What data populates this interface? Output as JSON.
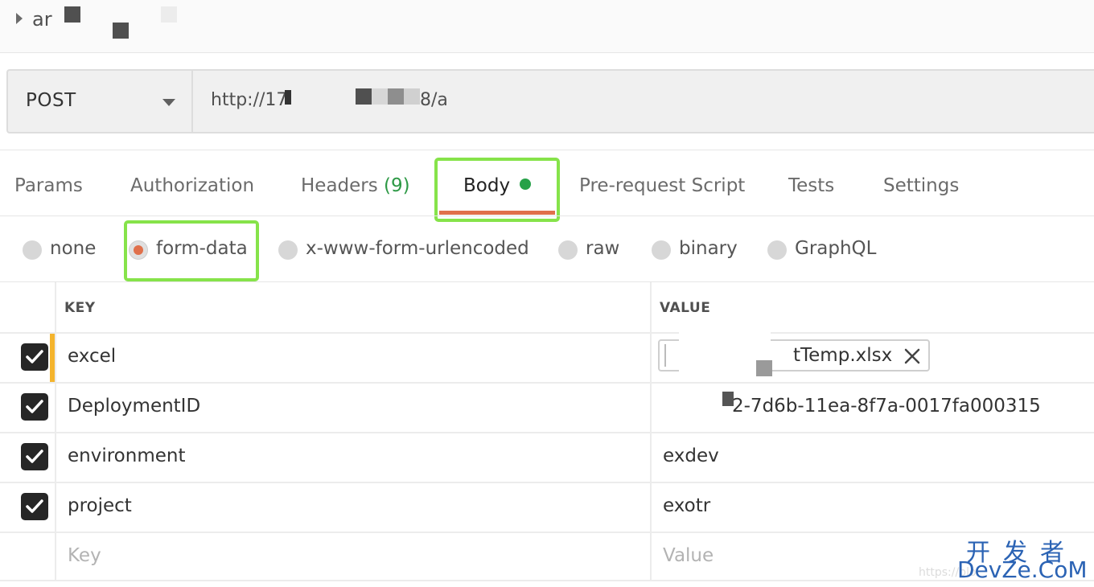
{
  "request": {
    "name": "ar",
    "method": "POST",
    "url_start": "http://17",
    "url_end": "8/a"
  },
  "tabs": [
    {
      "label": "Params"
    },
    {
      "label": "Authorization"
    },
    {
      "label": "Headers",
      "count": "(9)"
    },
    {
      "label": "Body",
      "active": true
    },
    {
      "label": "Pre-request Script"
    },
    {
      "label": "Tests"
    },
    {
      "label": "Settings"
    }
  ],
  "body_types": [
    {
      "label": "none",
      "selected": false
    },
    {
      "label": "form-data",
      "selected": true
    },
    {
      "label": "x-www-form-urlencoded",
      "selected": false
    },
    {
      "label": "raw",
      "selected": false
    },
    {
      "label": "binary",
      "selected": false
    },
    {
      "label": "GraphQL",
      "selected": false
    }
  ],
  "table": {
    "key_header": "KEY",
    "value_header": "VALUE",
    "rows": [
      {
        "key": "excel",
        "value": "tTemp.xlsx",
        "checked": true
      },
      {
        "key": "DeploymentID",
        "value": "2-7d6b-11ea-8f7a-0017fa000315",
        "checked": true
      },
      {
        "key": "environment",
        "value": "exdev",
        "checked": true
      },
      {
        "key": "project",
        "value": "exotr",
        "checked": true
      }
    ],
    "placeholder": {
      "key": "Key",
      "value": "Value"
    }
  },
  "watermark": {
    "chinese": "开发者",
    "latin": "DevZe.CoM",
    "url": "https://blo"
  },
  "colors": {
    "accent_orange": "#e0704b",
    "body_dot_green": "#26a148",
    "highlight_green": "#86e34a",
    "drag_yellow": "#f4b42d",
    "watermark_blue": "#2b63b4"
  }
}
